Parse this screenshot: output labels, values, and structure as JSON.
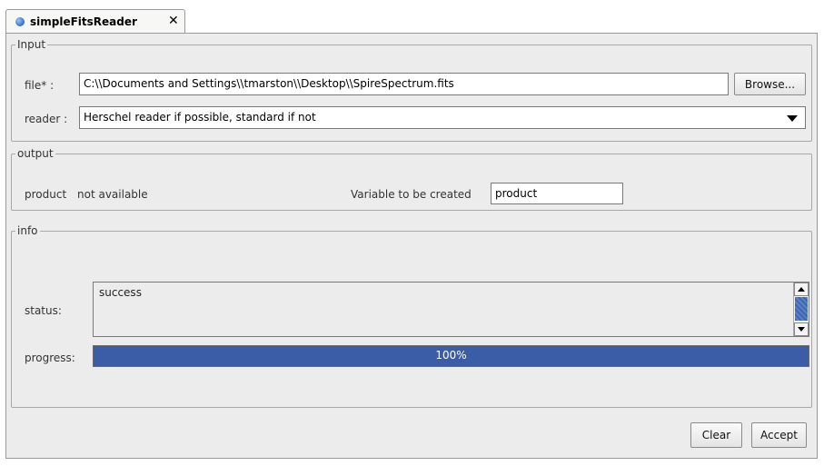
{
  "tab": {
    "title": "simpleFitsReader",
    "close_glyph": "✕"
  },
  "input": {
    "legend": "Input",
    "file_label": "file* :",
    "file_value": "C:\\\\Documents and Settings\\\\tmarston\\\\Desktop\\\\SpireSpectrum.fits",
    "browse_label": "Browse...",
    "reader_label": "reader :",
    "reader_value": "Herschel reader if possible, standard if not"
  },
  "output": {
    "legend": "output",
    "product_label": "product",
    "product_value": "not available",
    "variable_label": "Variable to be created",
    "variable_value": "product"
  },
  "info": {
    "legend": "info",
    "status_label": "status:",
    "status_text": "success",
    "progress_label": "progress:",
    "progress_percent": 100,
    "progress_text": "100%"
  },
  "footer": {
    "clear_label": "Clear",
    "accept_label": "Accept"
  },
  "colors": {
    "progress": "#3b5da7",
    "tab_dot": "#2f6fcc",
    "panel_bg": "#ececec"
  },
  "icons": {
    "tab": "blue-dot-icon",
    "close": "close-icon",
    "combo": "chevron-down-icon",
    "scroll_up": "arrow-up-icon",
    "scroll_down": "arrow-down-icon"
  }
}
